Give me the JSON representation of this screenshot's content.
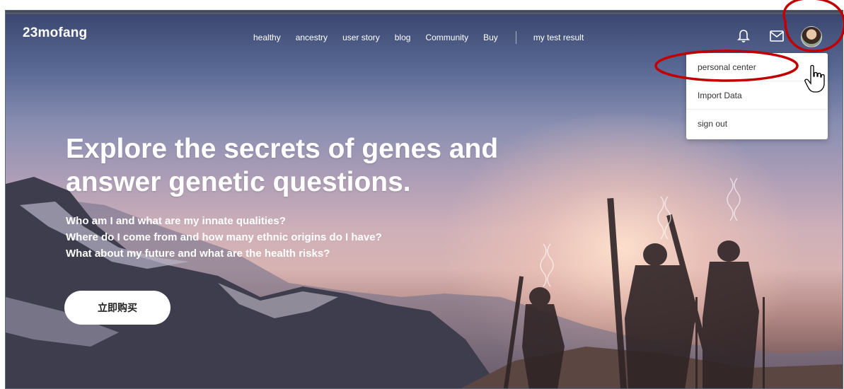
{
  "brand": {
    "logo": "23mofang"
  },
  "nav": {
    "links": [
      "healthy",
      "ancestry",
      "user story",
      "blog",
      "Community",
      "Buy"
    ],
    "result_link": "my test result"
  },
  "header_icons": [
    "bell-icon",
    "mail-icon",
    "avatar"
  ],
  "user_menu": {
    "items": [
      "personal center",
      "Import Data",
      "sign out"
    ]
  },
  "hero": {
    "title_line1": "Explore the secrets of genes and",
    "title_line2": "answer genetic questions.",
    "questions": [
      "Who am I and what are my innate qualities?",
      "Where do I come from and how many ethnic origins do I have?",
      "What about my future and what are the health risks?"
    ],
    "cta_label": "立即购买"
  },
  "colors": {
    "annotation_red": "#c00000",
    "window_border": "#5a6a80",
    "button_bg": "#ffffff"
  }
}
